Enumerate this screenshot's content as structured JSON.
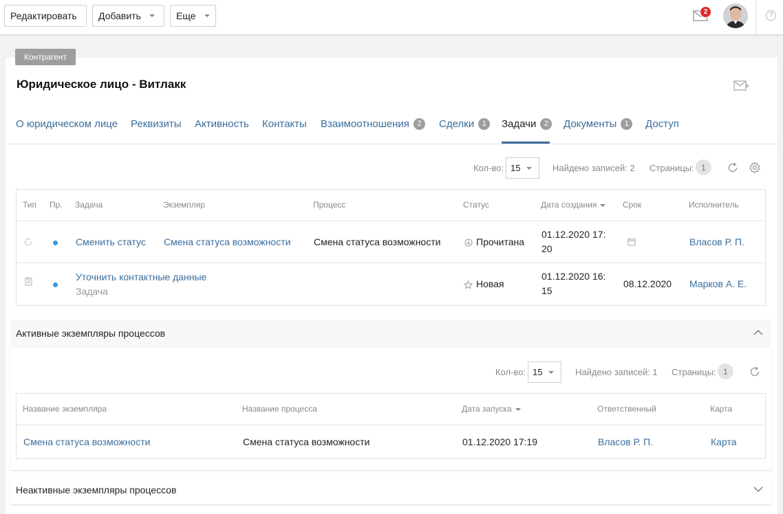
{
  "toolbar": {
    "edit_label": "Редактировать",
    "add_label": "Добавить",
    "more_label": "Еще",
    "notifications_count": "2",
    "help_glyph": "?"
  },
  "header": {
    "entity_tag": "Контрагент",
    "title": "Юридическое лицо - Витлакк"
  },
  "tabs": [
    {
      "label": "О юридическом лице",
      "badge": ""
    },
    {
      "label": "Реквизиты",
      "badge": ""
    },
    {
      "label": "Активность",
      "badge": ""
    },
    {
      "label": "Контакты",
      "badge": ""
    },
    {
      "label": "Взаимоотношения",
      "badge": "2"
    },
    {
      "label": "Сделки",
      "badge": "1"
    },
    {
      "label": "Задачи",
      "badge": "2"
    },
    {
      "label": "Документы",
      "badge": "1"
    },
    {
      "label": "Доступ",
      "badge": ""
    }
  ],
  "active_tab": "Задачи",
  "tasks_pager": {
    "count_label": "Кол-во:",
    "count_value": "15",
    "found_label": "Найдено записей: 2",
    "pages_label": "Страницы:",
    "page": "1"
  },
  "tasks_table": {
    "headers": [
      "Тип",
      "Пр.",
      "Задача",
      "Экземпляр",
      "Процесс",
      "Статус",
      "Дата создания",
      "Срок",
      "Исполнитель"
    ],
    "rows": [
      {
        "type_icon": "process-task-icon",
        "task": "Сменить статус",
        "task_sub": "",
        "instance": "Смена статуса возможности",
        "process": "Смена статуса возможности",
        "status_icon": "read-status-icon",
        "status": "Прочитана",
        "created_line1": "01.12.2020 17:",
        "created_line2": "20",
        "deadline": "",
        "deadline_icon": "calendar-icon",
        "assignee": "Власов Р. П."
      },
      {
        "type_icon": "clipboard-task-icon",
        "task": "Уточнить контактные данные",
        "task_sub": "Задача",
        "instance": "",
        "process": "",
        "status_icon": "star-status-icon",
        "status": "Новая",
        "created_line1": "01.12.2020 16:",
        "created_line2": "15",
        "deadline": "08.12.2020",
        "deadline_icon": "",
        "assignee": "Марков А. Е."
      }
    ]
  },
  "active_section": {
    "title": "Активные экземпляры процессов",
    "pager": {
      "count_label": "Кол-во:",
      "count_value": "15",
      "found_label": "Найдено записей: 1",
      "pages_label": "Страницы:",
      "page": "1"
    },
    "headers": [
      "Название экземпляра",
      "Название процесса",
      "Дата запуска",
      "Ответственный",
      "Карта"
    ],
    "rows": [
      {
        "instance": "Смена статуса возможности",
        "process": "Смена статуса возможности",
        "started": "01.12.2020 17:19",
        "owner": "Власов Р. П.",
        "map": "Карта"
      }
    ]
  },
  "inactive_section": {
    "title": "Неактивные экземпляры процессов"
  },
  "colors": {
    "link": "#3a6d9c",
    "badge": "#9e9e9e",
    "notification": "#e0262b",
    "priority_dot": "#3a9be0"
  }
}
